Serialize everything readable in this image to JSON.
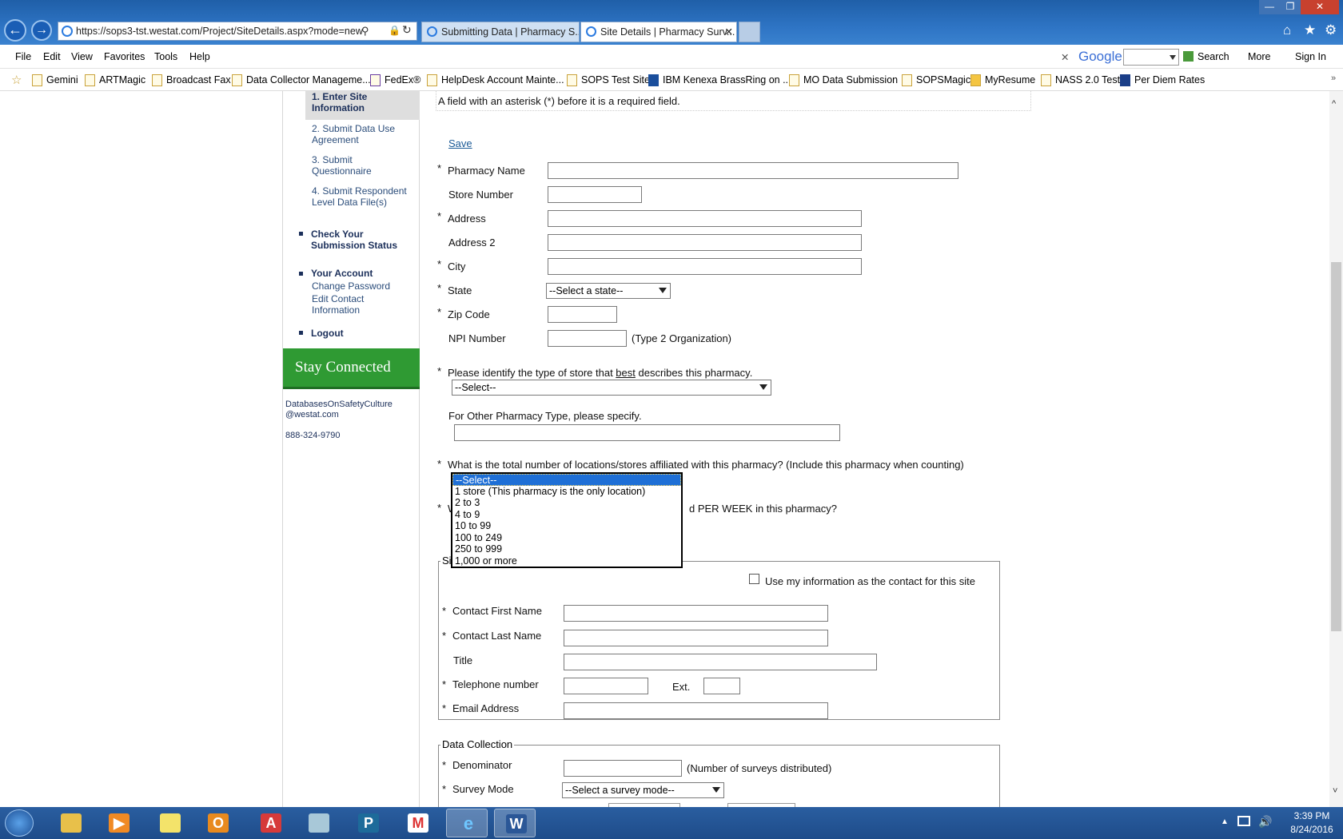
{
  "browser": {
    "url": "https://sops3-tst.westat.com/Project/SiteDetails.aspx?mode=new",
    "tabs": [
      {
        "label": "Submitting Data | Pharmacy S...",
        "active": false
      },
      {
        "label": "Site Details | Pharmacy Surv...",
        "active": true
      }
    ],
    "tab_close": "✕",
    "window_controls": [
      "—",
      "❐",
      "✕"
    ],
    "toolbar_icons": [
      "home-icon",
      "star-icon",
      "gear-icon"
    ]
  },
  "menubar": {
    "items": [
      "File",
      "Edit",
      "View",
      "Favorites",
      "Tools",
      "Help"
    ],
    "google": {
      "close": "✕",
      "logo": "Google",
      "search_label": "Search",
      "more_label": "More",
      "signin_label": "Sign In"
    }
  },
  "favorites": [
    "Gemini",
    "ARTMagic",
    "Broadcast Fax",
    "Data Collector Manageme...",
    "FedEx®",
    "HelpDesk Account Mainte...",
    "SOPS Test Site",
    "IBM Kenexa BrassRing on ...",
    "MO Data Submission",
    "SOPSMagic",
    "MyResume",
    "NASS 2.0 Test",
    "Per Diem Rates"
  ],
  "leftnav": {
    "steps": [
      "1. Enter Site Information",
      "2. Submit Data Use Agreement",
      "3. Submit Questionnaire",
      "4. Submit Respondent Level Data File(s)"
    ],
    "check_status": "Check Your Submission Status",
    "your_account": "Your Account",
    "change_password": "Change Password",
    "edit_contact": "Edit Contact Information",
    "logout": "Logout",
    "stay_connected": "Stay Connected",
    "email_line1": "DatabasesOnSafetyCulture",
    "email_line2": "@westat.com",
    "phone": "888-324-9790"
  },
  "form": {
    "required_note": "A field with an asterisk (*) before it is a required field.",
    "save_label": "Save",
    "asterisk": "*",
    "pharmacy_name": "Pharmacy Name",
    "store_number": "Store Number",
    "address": "Address",
    "address2": "Address 2",
    "city": "City",
    "state": "State",
    "state_value": "--Select a state--",
    "zip": "Zip Code",
    "npi": "NPI Number",
    "npi_note": "(Type 2 Organization)",
    "store_type_q_pre": "Please identify the type of store that ",
    "store_type_q_em": "best",
    "store_type_q_post": " describes this pharmacy.",
    "store_type_value": "--Select--",
    "other_type": "For Other Pharmacy Type, please specify.",
    "locations_q": "What is the total number of locations/stores affiliated with this pharmacy? (Include this pharmacy when counting)",
    "hours_q_start": "W",
    "hours_q_end": "d PER WEEK in this pharmacy?",
    "locations_options": [
      "--Select--",
      "1 store (This pharmacy is the only location)",
      "2 to 3",
      "4 to 9",
      "10 to 99",
      "100 to 249",
      "250 to 999",
      "1,000 or more"
    ],
    "site_contact": {
      "legend_partial": "Si",
      "use_my_info": "Use my information as the contact for this site",
      "first_name": "Contact First Name",
      "last_name": "Contact Last Name",
      "title": "Title",
      "telephone": "Telephone number",
      "ext": "Ext.",
      "email": "Email Address"
    },
    "data_collection": {
      "legend": "Data Collection",
      "denominator": "Denominator",
      "denominator_note": "(Number of surveys distributed)",
      "survey_mode": "Survey Mode",
      "survey_mode_value": "--Select a survey mode--"
    }
  },
  "taskbar": {
    "apps": [
      "start-orb",
      "file-explorer",
      "media-player",
      "sticky-notes",
      "outlook",
      "acrobat",
      "notepad",
      "publisher",
      "gmail",
      "internet-explorer",
      "word"
    ],
    "time": "3:39 PM",
    "date": "8/24/2016"
  },
  "colors": {
    "accent": "#2f9a33",
    "link": "#2a4c7a",
    "selected": "#1e6fd6"
  }
}
